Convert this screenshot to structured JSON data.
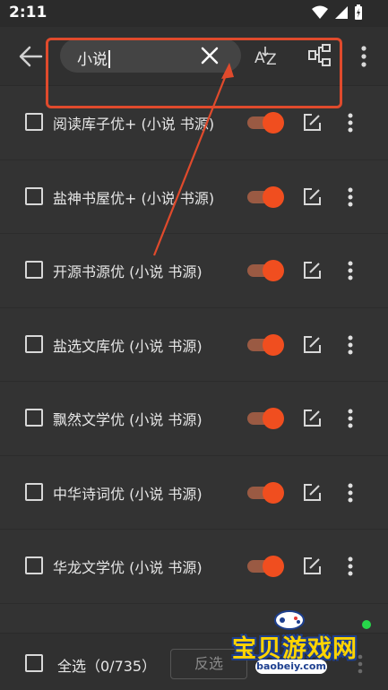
{
  "status": {
    "time": "2:11"
  },
  "appbar": {
    "search_value": "小说",
    "icons": {
      "back": "arrow-back-icon",
      "clear": "close-icon",
      "sort": "sort-az-icon",
      "group": "group-icon",
      "more": "more-vert-icon"
    }
  },
  "sources": [
    {
      "name": "阅读库子优+ (小说 书源)",
      "enabled": true
    },
    {
      "name": "盐神书屋优+ (小说 书源)",
      "enabled": true
    },
    {
      "name": "开源书源优 (小说 书源)",
      "enabled": true
    },
    {
      "name": "盐选文库优 (小说 书源)",
      "enabled": true
    },
    {
      "name": "飘然文学优 (小说 书源)",
      "enabled": true
    },
    {
      "name": "中华诗词优 (小说 书源)",
      "enabled": true
    },
    {
      "name": "华龙文学优 (小说 书源)",
      "enabled": true
    }
  ],
  "bottom": {
    "select_all_label": "全选（0/735）",
    "invert_label": "反选"
  },
  "watermark": {
    "title": "宝贝游戏网",
    "url": "baobeiy.com"
  },
  "colors": {
    "accent": "#f04e1f",
    "annotation": "#e04a2c",
    "background": "#333333"
  }
}
